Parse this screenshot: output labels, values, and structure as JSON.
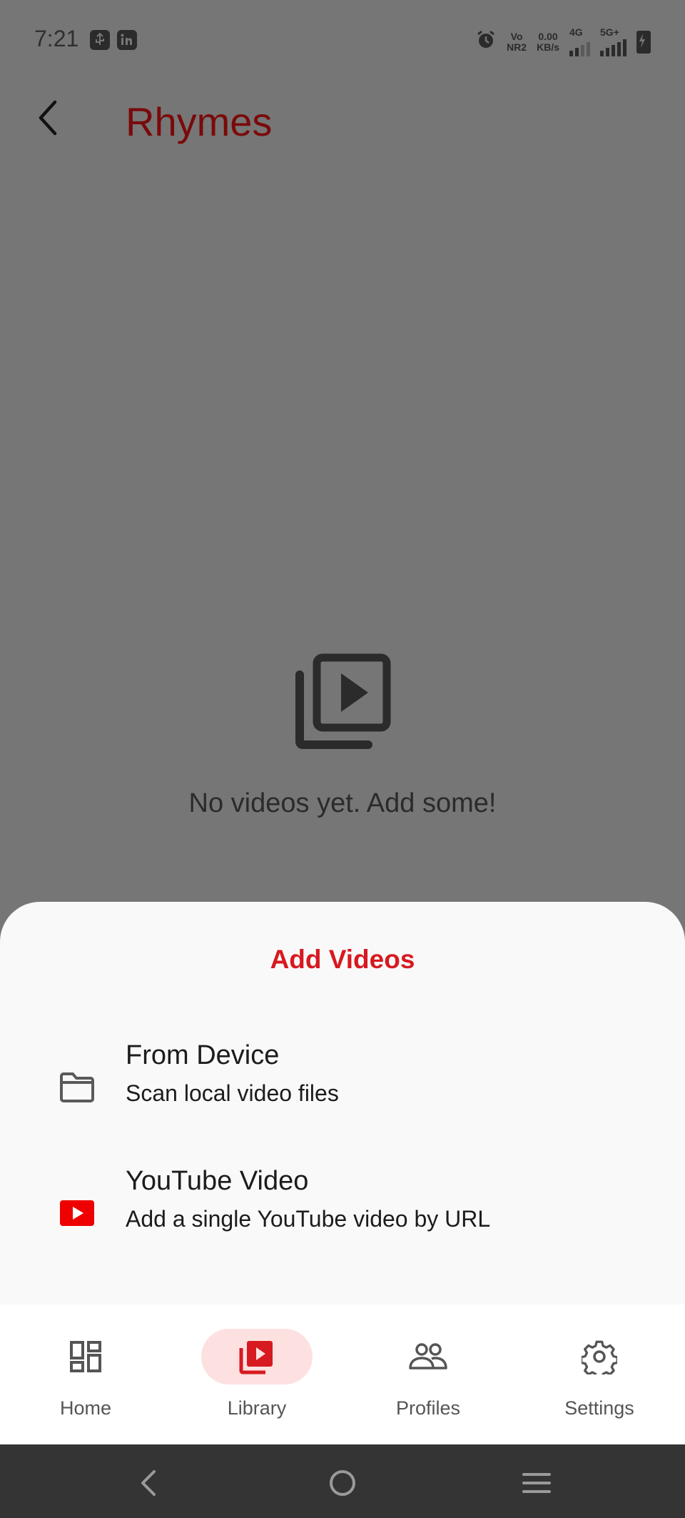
{
  "status_bar": {
    "time": "7:21",
    "volte_top": "Vo",
    "volte_bottom": "NR2",
    "speed_top": "0.00",
    "speed_bottom": "KB/s",
    "net1": "4G",
    "net2": "5G+"
  },
  "app_bar": {
    "title": "Rhymes"
  },
  "empty_state": {
    "message": "No videos yet. Add some!"
  },
  "sheet": {
    "title": "Add Videos",
    "options": [
      {
        "title": "From Device",
        "subtitle": "Scan local video files",
        "icon": "folder-icon"
      },
      {
        "title": "YouTube Video",
        "subtitle": "Add a single YouTube video by URL",
        "icon": "youtube-icon"
      }
    ]
  },
  "bottom_nav": {
    "items": [
      {
        "label": "Home",
        "icon": "dashboard-icon"
      },
      {
        "label": "Library",
        "icon": "video-library-icon",
        "active": true
      },
      {
        "label": "Profiles",
        "icon": "people-icon"
      },
      {
        "label": "Settings",
        "icon": "gear-icon"
      }
    ]
  },
  "colors": {
    "accent": "#d71920",
    "title_dimmed": "#7a0a0a",
    "active_pill": "#fde0e0",
    "scrim": "#767676"
  }
}
